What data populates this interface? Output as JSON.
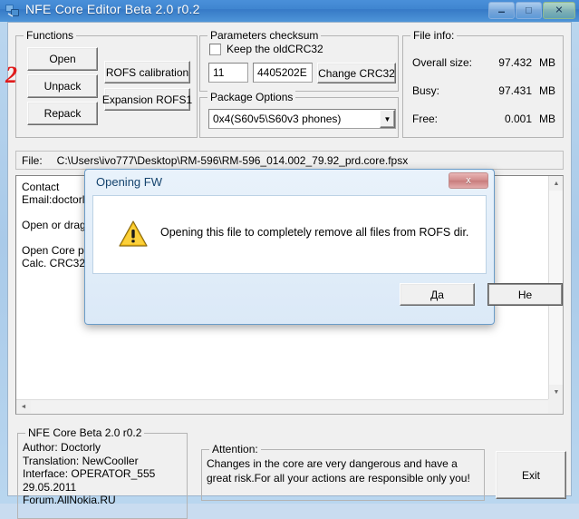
{
  "window": {
    "title": "NFE Core Editor Beta 2.0 r0.2",
    "icon": "app-icon",
    "controls": {
      "minimize": "–",
      "maximize": "□",
      "close": "✕"
    }
  },
  "annotation": {
    "step_number": "2",
    "color": "#e01b1b"
  },
  "functions": {
    "title": "Functions",
    "buttons": [
      {
        "label": "Open"
      },
      {
        "label": "Unpack"
      },
      {
        "label": "Repack"
      },
      {
        "label": "ROFS calibration"
      },
      {
        "label": "Expansion ROFS1"
      }
    ]
  },
  "checksum": {
    "title": "Parameters checksum",
    "keep_old_label": "Keep the oldCRC32",
    "keep_old_checked": false,
    "field1": "11",
    "field2": "4405202E",
    "change_button": "Change CRC32"
  },
  "package": {
    "title": "Package Options",
    "selected": "0x4(S60v5\\S60v3 phones)",
    "arrow": "▼"
  },
  "file_info": {
    "title": "File info:",
    "rows": [
      {
        "label": "Overall size:",
        "value": "97.432",
        "unit": "MB"
      },
      {
        "label": "Busy:",
        "value": "97.431",
        "unit": "MB"
      },
      {
        "label": "Free:",
        "value": "0.001",
        "unit": "MB"
      }
    ]
  },
  "file_bar": {
    "label": "File:",
    "path": "C:\\Users\\ivo777\\Desktop\\RM-596\\RM-596_014.002_79.92_prd.core.fpsx"
  },
  "log": {
    "text": "Contact\nEmail:doctorly@\n\nOpen or drag\n\nOpen Core pa\nCalc. CRC32...",
    "scroll_up": "▲",
    "scroll_down": "▼",
    "scroll_left": "◄"
  },
  "dialog": {
    "title": "Opening FW",
    "close_label": "x",
    "icon": "warning-triangle-icon",
    "message": "Opening this file to completely remove all files from ROFS dir.",
    "yes_label": "Да",
    "no_label": "Не"
  },
  "about": {
    "title": "NFE Core Beta 2.0 r0.2",
    "lines": "Author: Doctorly\nTranslation: NewCooller\nInterface: OPERATOR_555\n29.05.2011\nForum.AllNokia.RU"
  },
  "attention": {
    "title": "Attention:",
    "lines": "Changes in the core are very dangerous and have a\ngreat risk.For all your actions are responsible only you!"
  },
  "exit": {
    "label": "Exit"
  }
}
